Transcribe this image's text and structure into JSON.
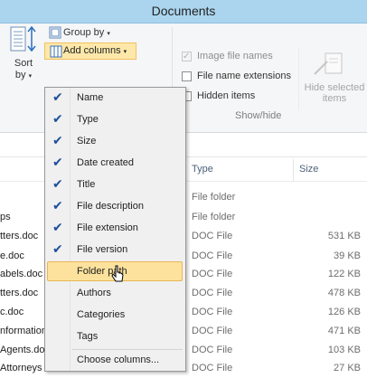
{
  "window": {
    "title": "Documents"
  },
  "ribbon": {
    "sort_label_line1": "Sort",
    "sort_label_line2": "by",
    "group_by_label": "Group by",
    "add_columns_label": "Add columns",
    "options": [
      {
        "label": "Image file names",
        "checked": true,
        "disabled": true
      },
      {
        "label": "File name extensions",
        "checked": false,
        "disabled": false
      },
      {
        "label": "Hidden items",
        "checked": false,
        "disabled": false
      }
    ],
    "hide_selected_line1": "Hide selected",
    "hide_selected_line2": "items",
    "group_label": "Show/hide"
  },
  "menu": {
    "items": [
      {
        "label": "Name",
        "checked": true
      },
      {
        "label": "Type",
        "checked": true
      },
      {
        "label": "Size",
        "checked": true
      },
      {
        "label": "Date created",
        "checked": true
      },
      {
        "label": "Title",
        "checked": true
      },
      {
        "label": "File description",
        "checked": true
      },
      {
        "label": "File extension",
        "checked": true
      },
      {
        "label": "File version",
        "checked": true
      },
      {
        "label": "Folder path",
        "checked": false,
        "highlighted": true
      },
      {
        "label": "Authors",
        "checked": false
      },
      {
        "label": "Categories",
        "checked": false
      },
      {
        "label": "Tags",
        "checked": false
      }
    ],
    "choose_columns_label": "Choose columns...",
    "check_glyph": "✔"
  },
  "file_list": {
    "headers": {
      "type": "Type",
      "size": "Size"
    },
    "rows": [
      {
        "name": "",
        "type": "File folder",
        "size": ""
      },
      {
        "name": "ps",
        "type": "File folder",
        "size": ""
      },
      {
        "name": "tters.doc",
        "type": "DOC File",
        "size": "531 KB"
      },
      {
        "name": "e.doc",
        "type": "DOC File",
        "size": "39 KB"
      },
      {
        "name": "abels.doc",
        "type": "DOC File",
        "size": "122 KB"
      },
      {
        "name": "tters.doc",
        "type": "DOC File",
        "size": "478 KB"
      },
      {
        "name": "c.doc",
        "type": "DOC File",
        "size": "126 KB"
      },
      {
        "name": "nformation",
        "type": "DOC File",
        "size": "471 KB"
      },
      {
        "name": "Agents.doc",
        "type": "DOC File",
        "size": "103 KB"
      },
      {
        "name": "Attorneys",
        "type": "DOC File",
        "size": "27 KB"
      }
    ]
  },
  "colors": {
    "titlebar": "#abd5ef",
    "highlight": "#fde29d",
    "check": "#1c4f9c"
  },
  "icons": [
    "sort-icon",
    "group-by-icon",
    "add-columns-icon",
    "dropdown-arrow-icon",
    "hide-selected-icon",
    "mouse-cursor-icon"
  ]
}
